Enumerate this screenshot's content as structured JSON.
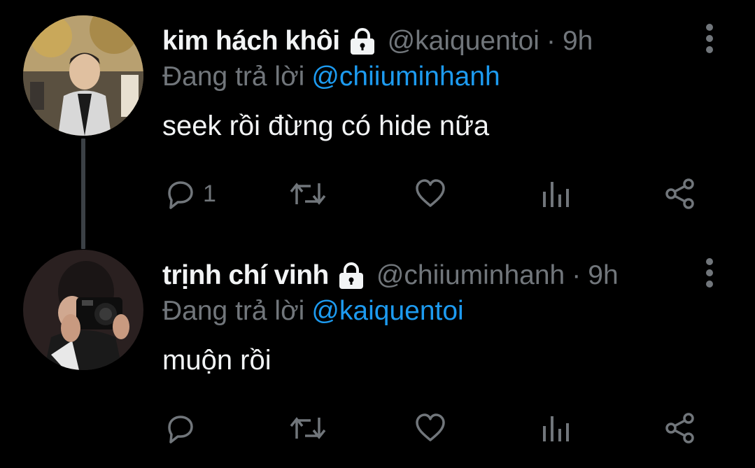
{
  "colors": {
    "background": "#000000",
    "text_primary": "#f2f4f5",
    "text_secondary": "#71767b",
    "accent": "#1d9bf0"
  },
  "tweets": [
    {
      "name": "kim hách khôi",
      "handle": "@kaiquentoi",
      "separator": "·",
      "time": "9h",
      "reply_prefix": "Đang trả lời",
      "reply_to": "@chiiuminhanh",
      "text": "seek rồi đừng có hide nữa",
      "reply_count": "1",
      "icons": [
        "lock-icon",
        "more-vertical-icon",
        "reply-icon",
        "retweet-icon",
        "like-icon",
        "analytics-icon",
        "share-icon"
      ]
    },
    {
      "name": "trịnh chí vinh",
      "handle": "@chiiuminhanh",
      "separator": "·",
      "time": "9h",
      "reply_prefix": "Đang trả lời",
      "reply_to": "@kaiquentoi",
      "text": "muộn rồi",
      "reply_count": "",
      "icons": [
        "lock-icon",
        "more-vertical-icon",
        "reply-icon",
        "retweet-icon",
        "like-icon",
        "analytics-icon",
        "share-icon"
      ]
    }
  ]
}
